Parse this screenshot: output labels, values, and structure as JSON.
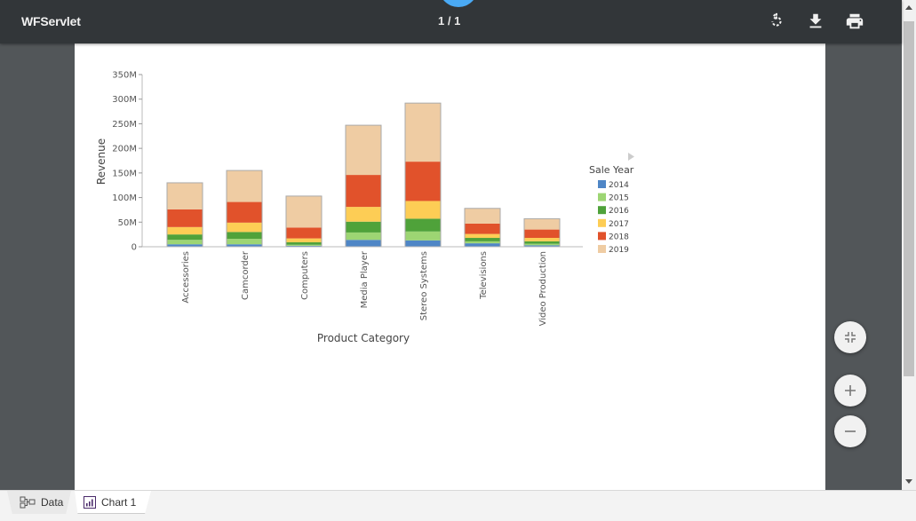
{
  "header": {
    "app_title": "WFServlet",
    "page_indicator": "1 / 1",
    "icons": [
      "rotate-icon",
      "download-icon",
      "print-icon"
    ]
  },
  "zoom_controls": [
    "fit-page-icon",
    "zoom-in-icon",
    "zoom-out-icon"
  ],
  "tabs": [
    {
      "label": "Data",
      "icon": "data-flow-icon"
    },
    {
      "label": "Chart 1",
      "icon": "bar-chart-icon",
      "active": true
    }
  ],
  "colors": {
    "topbar": "#323639",
    "viewer_bg": "#525659",
    "accent_dot": "#4aaaf5"
  },
  "chart_data": {
    "type": "bar",
    "stacked": true,
    "title": "",
    "xlabel": "Product Category",
    "ylabel": "Revenue",
    "ylim": [
      0,
      350000000
    ],
    "yticks": [
      0,
      50000000,
      100000000,
      150000000,
      200000000,
      250000000,
      300000000,
      350000000
    ],
    "ytick_labels": [
      "0",
      "50M",
      "100M",
      "150M",
      "200M",
      "250M",
      "300M",
      "350M"
    ],
    "grid": false,
    "categories": [
      "Accessories",
      "Camcorder",
      "Computers",
      "Media Player",
      "Stereo Systems",
      "Televisions",
      "Video Production"
    ],
    "legend": {
      "title": "Sale Year",
      "position": "right"
    },
    "series": [
      {
        "name": "2014",
        "color": "#4f86c6",
        "values": [
          5000000,
          5000000,
          2000000,
          14000000,
          13000000,
          7000000,
          3000000
        ]
      },
      {
        "name": "2015",
        "color": "#9dd573",
        "values": [
          9000000,
          11000000,
          2000000,
          15000000,
          18000000,
          4000000,
          3000000
        ]
      },
      {
        "name": "2016",
        "color": "#4fa23a",
        "values": [
          11000000,
          14000000,
          5000000,
          22000000,
          26000000,
          7000000,
          5000000
        ]
      },
      {
        "name": "2017",
        "color": "#fdcd55",
        "values": [
          15000000,
          19000000,
          8000000,
          30000000,
          36000000,
          8000000,
          7000000
        ]
      },
      {
        "name": "2018",
        "color": "#e1522b",
        "values": [
          36000000,
          42000000,
          22000000,
          65000000,
          80000000,
          21000000,
          17000000
        ]
      },
      {
        "name": "2019",
        "color": "#efcca3",
        "values": [
          54000000,
          64000000,
          64000000,
          101000000,
          119000000,
          31000000,
          22000000
        ]
      }
    ]
  }
}
